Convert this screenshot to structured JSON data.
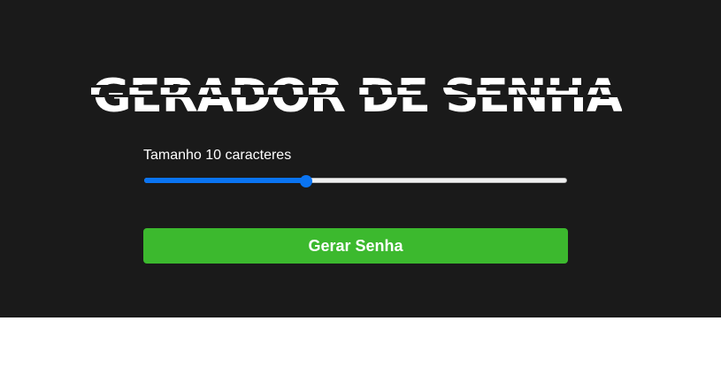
{
  "app": {
    "title": "GERADOR DE SENHA",
    "size_label": "Tamanho 10 caracteres",
    "slider": {
      "value_fraction": 0.38
    },
    "generate_button_label": "Gerar Senha"
  },
  "colors": {
    "background": "#1a1a1a",
    "accent_blue": "#0a74f2",
    "button_green": "#3cb92e",
    "text": "#ffffff"
  }
}
